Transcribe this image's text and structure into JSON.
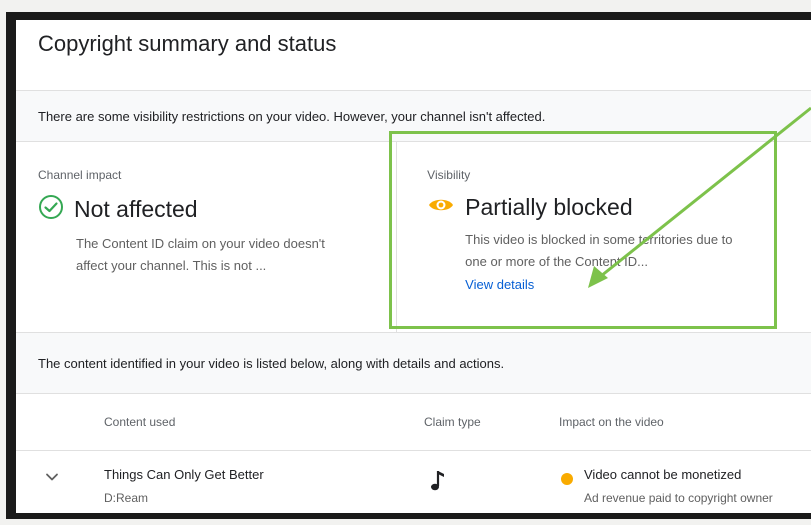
{
  "header": {
    "title": "Copyright summary and status"
  },
  "notice": {
    "text": "There are some visibility restrictions on your video. However, your channel isn't affected."
  },
  "cards": {
    "channel_impact": {
      "label": "Channel impact",
      "status": "Not affected",
      "description": "The Content ID claim on your video doesn't affect your channel. This is not ...",
      "icon": "check-circle-icon",
      "color": "#34a853"
    },
    "visibility": {
      "label": "Visibility",
      "status": "Partially blocked",
      "description": "This video is blocked in some territories due to one or more of the Content ID...",
      "link": "View details",
      "icon": "eye-icon",
      "color": "#f9ab00"
    }
  },
  "content_note": {
    "text": "The content identified in your video is listed below, along with details and actions."
  },
  "table": {
    "headers": {
      "content": "Content used",
      "claim": "Claim type",
      "impact": "Impact on the video"
    },
    "rows": [
      {
        "title": "Things Can Only Get Better",
        "artist": "D:Ream",
        "claim_icon": "music-note-icon",
        "impact": "Video cannot be monetized",
        "impact_detail": "Ad revenue paid to copyright owner"
      }
    ]
  },
  "annotation": {
    "color": "#7dc24b"
  }
}
